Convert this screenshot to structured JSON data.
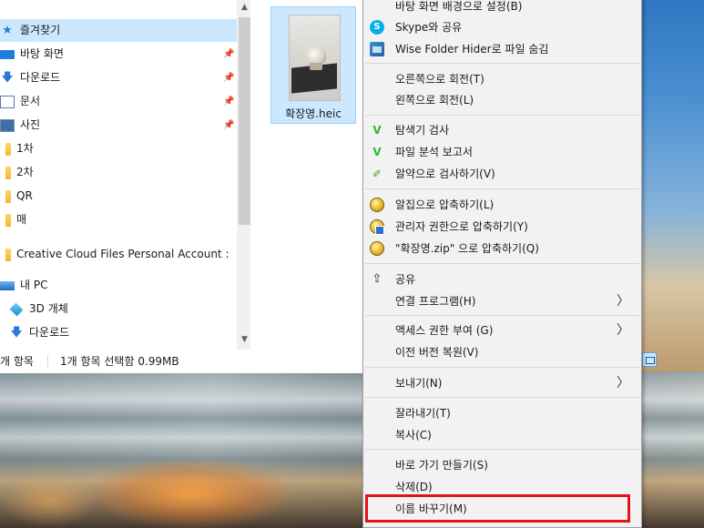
{
  "nav": {
    "items": [
      {
        "label": "즐겨찾기",
        "icon": "star-icon"
      },
      {
        "label": "바탕 화면",
        "icon": "desktop-folder-icon",
        "pinned": true
      },
      {
        "label": "다운로드",
        "icon": "download-arrow-icon",
        "pinned": true
      },
      {
        "label": "문서",
        "icon": "document-icon",
        "pinned": true
      },
      {
        "label": "사진",
        "icon": "picture-icon",
        "pinned": true
      },
      {
        "label": "1차",
        "icon": "folder-icon"
      },
      {
        "label": "2차",
        "icon": "folder-icon"
      },
      {
        "label": "QR",
        "icon": "folder-icon"
      },
      {
        "label": "매",
        "icon": "folder-icon"
      },
      {
        "label": "Creative Cloud Files Personal Account :",
        "icon": "folder-icon"
      },
      {
        "label": "내 PC",
        "icon": "pc-icon"
      },
      {
        "label": "3D 개체",
        "icon": "3d-objects-icon"
      },
      {
        "label": "다운로드",
        "icon": "download-arrow-icon"
      }
    ],
    "pin_glyph": "📌",
    "scroll_up": "▲",
    "scroll_down": "▼"
  },
  "file": {
    "name": "확장명.heic"
  },
  "status": {
    "item_count": "개 항목",
    "selection": "1개 항목 선택함 0.99MB"
  },
  "menu": {
    "items": [
      {
        "label": "바탕 화면 배경으로 설정(B)",
        "icon": ""
      },
      {
        "label": "Skype와 공유",
        "icon": "skype-icon"
      },
      {
        "label": "Wise Folder Hider로 파일 숨김",
        "icon": "wise-folder-hider-icon"
      },
      {
        "label": "오른쪽으로 회전(T)",
        "icon": ""
      },
      {
        "label": "왼쪽으로 회전(L)",
        "icon": ""
      },
      {
        "label": "탐색기 검사",
        "icon": "v3-icon"
      },
      {
        "label": "파일 분석 보고서",
        "icon": "v3-icon"
      },
      {
        "label": "알약으로 검사하기(V)",
        "icon": "alyac-pencil-icon"
      },
      {
        "label": "알집으로 압축하기(L)",
        "icon": "alzip-icon"
      },
      {
        "label": "관리자 권한으로 압축하기(Y)",
        "icon": "alzip-admin-icon"
      },
      {
        "label": "\"확장명.zip\" 으로 압축하기(Q)",
        "icon": "alzip-icon"
      },
      {
        "label": "공유",
        "icon": "share-icon"
      },
      {
        "label": "연결 프로그램(H)",
        "icon": "",
        "submenu": true
      },
      {
        "label": "액세스 권한 부여 (G)",
        "icon": "",
        "submenu": true
      },
      {
        "label": "이전 버전 복원(V)",
        "icon": ""
      },
      {
        "label": "보내기(N)",
        "icon": "",
        "submenu": true
      },
      {
        "label": "잘라내기(T)",
        "icon": ""
      },
      {
        "label": "복사(C)",
        "icon": ""
      },
      {
        "label": "바로 가기 만들기(S)",
        "icon": ""
      },
      {
        "label": "삭제(D)",
        "icon": ""
      },
      {
        "label": "이름 바꾸기(M)",
        "icon": "",
        "highlighted": true
      }
    ],
    "chevron": "〉",
    "v3_glyph": "V",
    "pencil_glyph": "✐",
    "skype_glyph": "S",
    "share_glyph": "⇪"
  },
  "colors": {
    "selection_bg": "#cce8ff",
    "highlight_border": "#e0131c",
    "menu_bg": "#f2f2f2"
  }
}
